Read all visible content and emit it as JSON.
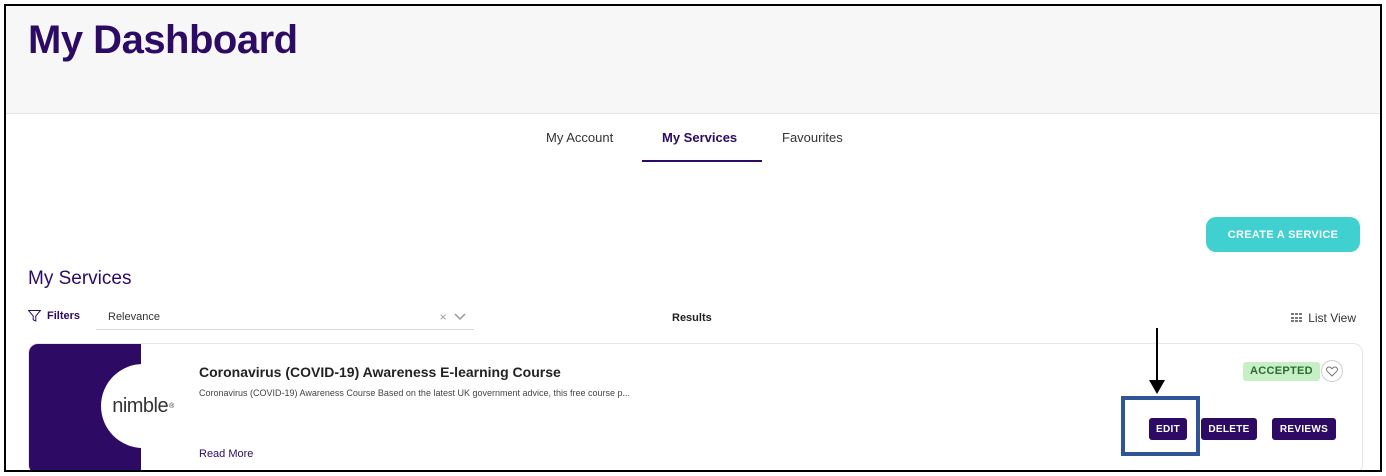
{
  "header": {
    "title": "My Dashboard"
  },
  "tabs": [
    {
      "label": "My Account",
      "active": false
    },
    {
      "label": "My Services",
      "active": true
    },
    {
      "label": "Favourites",
      "active": false
    }
  ],
  "actions": {
    "create_label": "CREATE A SERVICE"
  },
  "section": {
    "title": "My Services"
  },
  "toolbar": {
    "filters_label": "Filters",
    "sort_value": "Relevance",
    "clear_symbol": "×",
    "results_label": "Results",
    "view_label": "List View"
  },
  "service": {
    "logo_text": "nimble",
    "logo_mark": "®",
    "title": "Coronavirus (COVID-19) Awareness E-learning Course",
    "description": "Coronavirus (COVID-19) Awareness Course Based on the latest UK government advice, this free course p...",
    "read_more": "Read More",
    "status": "ACCEPTED",
    "buttons": {
      "edit": "EDIT",
      "delete": "DELETE",
      "reviews": "REVIEWS"
    }
  },
  "colors": {
    "brand_purple": "#2d0a63",
    "accent_teal": "#3fd0cf",
    "status_green_bg": "#c6efc6",
    "annotation_blue": "#2f5597"
  }
}
